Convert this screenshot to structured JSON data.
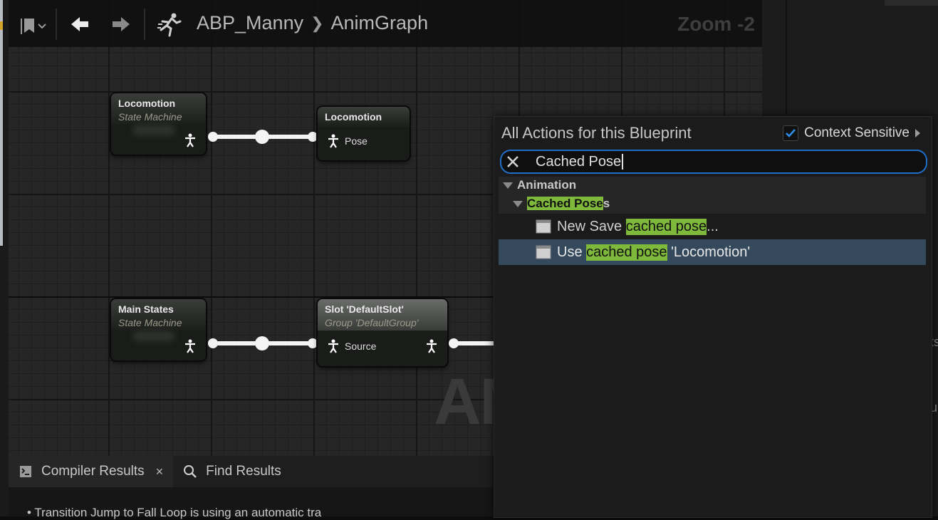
{
  "toolbar": {
    "breadcrumb_root": "ABP_Manny",
    "breadcrumb_leaf": "AnimGraph",
    "zoom": "Zoom -2"
  },
  "graph": {
    "watermark": "AN",
    "nodes": {
      "locomotion_sm": {
        "title": "Locomotion",
        "subtitle": "State Machine"
      },
      "locomotion_cached": {
        "title": "Locomotion",
        "pin": "Pose"
      },
      "main_states": {
        "title": "Main States",
        "subtitle": "State Machine"
      },
      "slot": {
        "title": "Slot 'DefaultSlot'",
        "subtitle": "Group 'DefaultGroup'",
        "pin": "Source"
      }
    }
  },
  "bottom_panel": {
    "tabs": [
      {
        "label": "Compiler Results",
        "close": "×"
      },
      {
        "label": "Find Results"
      }
    ],
    "message": "Transition  Jump to Fall Loop  is using an automatic tra"
  },
  "action_menu": {
    "title": "All Actions for this Blueprint",
    "context_sensitive_label": "Context Sensitive",
    "context_sensitive_checked": true,
    "search_value": "Cached Pose",
    "category": "Animation",
    "subcategory_highlight": "Cached Pose",
    "subcategory_rest": "s",
    "items": [
      {
        "prefix": "New Save ",
        "highlight": "cached pose",
        "suffix": "..."
      },
      {
        "prefix": "Use ",
        "highlight": "cached pose",
        "suffix": " 'Locomotion'"
      }
    ]
  },
  "right_panel": {
    "clipped_text_1": "ts",
    "clipped_text_2": "ur"
  },
  "colors": {
    "accent_blue": "#1f6fc9",
    "highlight_green": "#7fb93b",
    "selection": "#35495c"
  }
}
